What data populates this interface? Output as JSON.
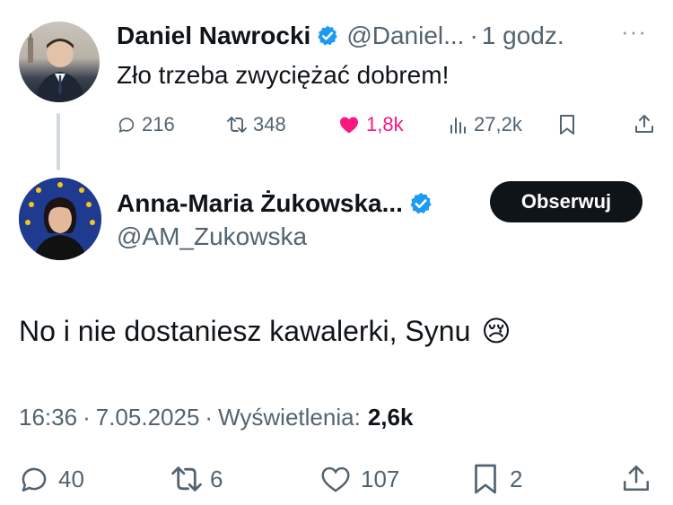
{
  "parent_tweet": {
    "author_name": "Daniel Nawrocki",
    "handle": "@Daniel...",
    "separator": "·",
    "time": "1 godz.",
    "more_label": "···",
    "text": "Zło trzeba zwyciężać dobrem!",
    "stats": {
      "replies": "216",
      "reposts": "348",
      "likes": "1,8k",
      "views": "27,2k"
    },
    "like_color": "#f91880"
  },
  "reply_tweet": {
    "author_name": "Anna-Maria Żukowska...",
    "handle": "@AM_Zukowska",
    "follow_label": "Obserwuj",
    "text": "No i nie dostaniesz kawalerki, Synu",
    "emoji": "😢",
    "meta": {
      "time": "16:36",
      "sep1": "·",
      "date": "7.05.2025",
      "sep2": "·",
      "views_label": "Wyświetlenia:",
      "views_value": "2,6k"
    },
    "actions": {
      "replies": "40",
      "reposts": "6",
      "likes": "107",
      "bookmarks": "2"
    }
  },
  "colors": {
    "verified": "#1d9bf0",
    "text": "#0f1419",
    "muted": "#536471",
    "follow_bg": "#0f1419"
  }
}
